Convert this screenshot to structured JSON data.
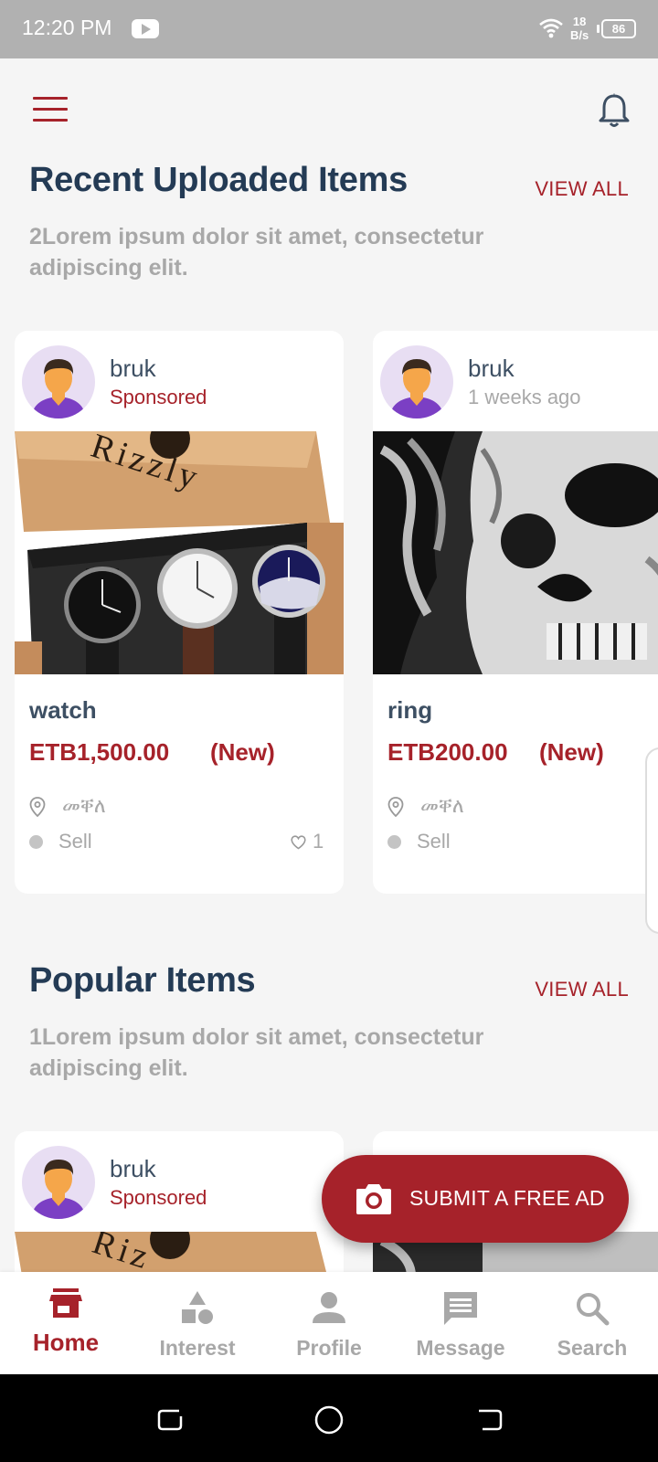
{
  "status_bar": {
    "time": "12:20 PM",
    "net_speed_value": "18",
    "net_speed_unit": "B/s",
    "battery": "86",
    "icons": [
      "youtube-icon",
      "wifi-icon",
      "battery-icon"
    ]
  },
  "header": {
    "icons": [
      "menu-icon",
      "bell-icon"
    ]
  },
  "recent": {
    "title": "Recent Uploaded Items",
    "view_all": "VIEW ALL",
    "description": "2Lorem ipsum dolor sit amet, consectetur adipiscing elit.",
    "items": [
      {
        "seller": "bruk",
        "tag": "Sponsored",
        "title": "watch",
        "price": "ETB1,500.00",
        "condition": "(New)",
        "location": "መቐለ",
        "type": "Sell",
        "favorites": "1"
      },
      {
        "seller": "bruk",
        "tag": "1 weeks ago",
        "title": "ring",
        "price": "ETB200.00",
        "condition": "(New)",
        "location": "መቐለ",
        "type": "Sell"
      }
    ]
  },
  "popular": {
    "title": "Popular Items",
    "view_all": "VIEW ALL",
    "description": "1Lorem ipsum dolor sit amet, consectetur adipiscing elit.",
    "items": [
      {
        "seller": "bruk",
        "tag": "Sponsored"
      }
    ]
  },
  "fab": {
    "label": "SUBMIT A FREE AD",
    "icon": "camera-icon"
  },
  "bottom_nav": {
    "active": "Home",
    "items": [
      {
        "label": "Home",
        "icon": "store-icon"
      },
      {
        "label": "Interest",
        "icon": "shapes-icon"
      },
      {
        "label": "Profile",
        "icon": "person-icon"
      },
      {
        "label": "Message",
        "icon": "message-icon"
      },
      {
        "label": "Search",
        "icon": "search-icon"
      }
    ]
  },
  "colors": {
    "accent": "#a6222a",
    "heading": "#243b55",
    "muted": "#a8a8a8",
    "background": "#f5f5f5",
    "status_bar": "#b1b1b1"
  }
}
